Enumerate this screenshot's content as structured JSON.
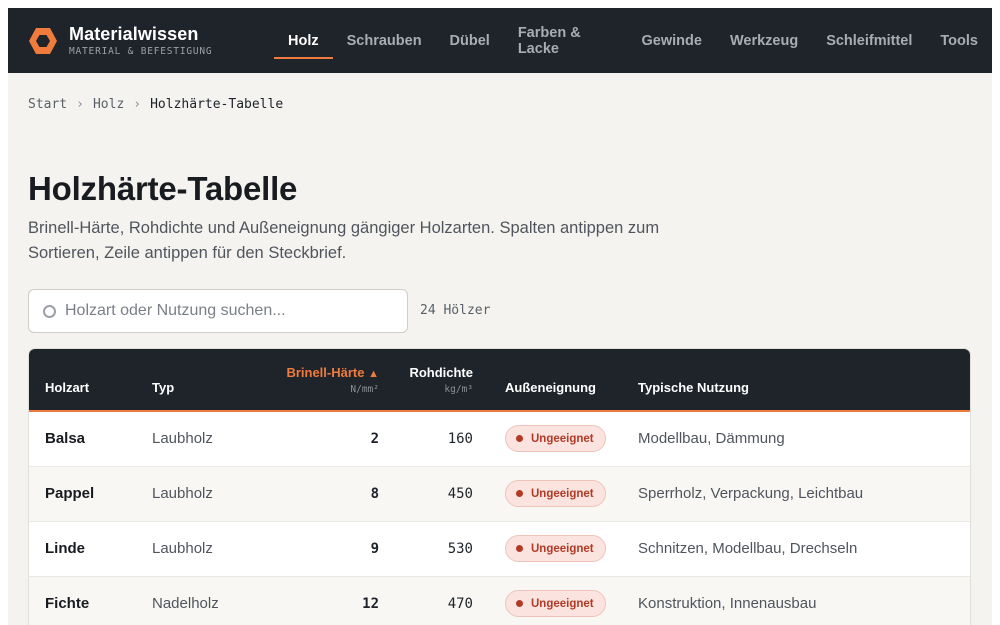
{
  "brand": {
    "title": "Materialwissen",
    "subtitle": "MATERIAL & BEFESTIGUNG",
    "accent": "#ef7b3d"
  },
  "nav": {
    "items": [
      {
        "label": "Holz",
        "active": true
      },
      {
        "label": "Schrauben"
      },
      {
        "label": "Dübel"
      },
      {
        "label": "Farben & Lacke"
      },
      {
        "label": "Gewinde"
      },
      {
        "label": "Werkzeug"
      },
      {
        "label": "Schleifmittel"
      },
      {
        "label": "Tools"
      }
    ]
  },
  "breadcrumb": {
    "items": [
      "Start",
      "Holz",
      "Holzhärte-Tabelle"
    ],
    "separator": "›"
  },
  "page": {
    "title": "Holzhärte-Tabelle",
    "description": "Brinell-Härte, Rohdichte und Außeneignung gängiger Holzarten. Spalten antippen zum Sortieren, Zeile antippen für den Steckbrief."
  },
  "search": {
    "placeholder": "Holzart oder Nutzung suchen...",
    "value": "",
    "icon": "search-icon"
  },
  "count_label": "24 Hölzer",
  "table": {
    "columns": {
      "holzart": "Holzart",
      "typ": "Typ",
      "brinell": "Brinell-Härte",
      "brinell_sort_arrow": "▲",
      "brinell_unit": "N/mm²",
      "rohdichte": "Rohdichte",
      "rohdichte_unit": "kg/m³",
      "aussen": "Außeneignung",
      "nutzung": "Typische Nutzung"
    },
    "rows": [
      {
        "name": "Balsa",
        "type": "Laubholz",
        "hardness": "2",
        "density": "160",
        "suitability": "Ungeeignet",
        "usage": "Modellbau, Dämmung"
      },
      {
        "name": "Pappel",
        "type": "Laubholz",
        "hardness": "8",
        "density": "450",
        "suitability": "Ungeeignet",
        "usage": "Sperrholz, Verpackung, Leichtbau"
      },
      {
        "name": "Linde",
        "type": "Laubholz",
        "hardness": "9",
        "density": "530",
        "suitability": "Ungeeignet",
        "usage": "Schnitzen, Modellbau, Drechseln"
      },
      {
        "name": "Fichte",
        "type": "Nadelholz",
        "hardness": "12",
        "density": "470",
        "suitability": "Ungeeignet",
        "usage": "Konstruktion, Innenausbau"
      }
    ]
  }
}
